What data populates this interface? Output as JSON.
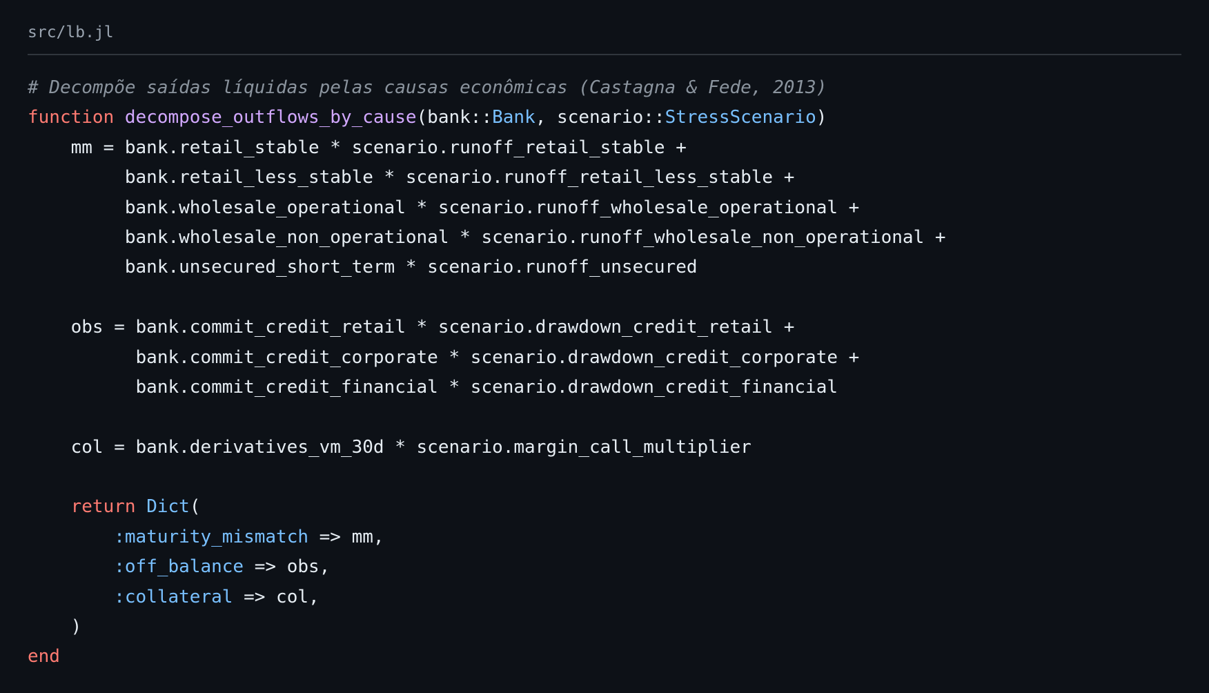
{
  "file": {
    "path": "src/lb.jl"
  },
  "colors": {
    "background": "#0d1117",
    "text": "#e6edf3",
    "comment": "#8b949e",
    "keyword": "#ff7b72",
    "function": "#d2a8ff",
    "type": "#79c0ff",
    "divider": "#30363d"
  },
  "code_lines": [
    [
      {
        "t": "comment",
        "v": "# Decompõe saídas líquidas pelas causas econômicas (Castagna & Fede, 2013)"
      }
    ],
    [
      {
        "t": "keyword",
        "v": "function"
      },
      {
        "t": "plain",
        "v": " "
      },
      {
        "t": "fn",
        "v": "decompose_outflows_by_cause"
      },
      {
        "t": "plain",
        "v": "(bank::"
      },
      {
        "t": "type",
        "v": "Bank"
      },
      {
        "t": "plain",
        "v": ", scenario::"
      },
      {
        "t": "type",
        "v": "StressScenario"
      },
      {
        "t": "plain",
        "v": ")"
      }
    ],
    [
      {
        "t": "plain",
        "v": "    mm = bank.retail_stable * scenario.runoff_retail_stable +"
      }
    ],
    [
      {
        "t": "plain",
        "v": "         bank.retail_less_stable * scenario.runoff_retail_less_stable +"
      }
    ],
    [
      {
        "t": "plain",
        "v": "         bank.wholesale_operational * scenario.runoff_wholesale_operational +"
      }
    ],
    [
      {
        "t": "plain",
        "v": "         bank.wholesale_non_operational * scenario.runoff_wholesale_non_operational +"
      }
    ],
    [
      {
        "t": "plain",
        "v": "         bank.unsecured_short_term * scenario.runoff_unsecured"
      }
    ],
    [
      {
        "t": "plain",
        "v": ""
      }
    ],
    [
      {
        "t": "plain",
        "v": "    obs = bank.commit_credit_retail * scenario.drawdown_credit_retail +"
      }
    ],
    [
      {
        "t": "plain",
        "v": "          bank.commit_credit_corporate * scenario.drawdown_credit_corporate +"
      }
    ],
    [
      {
        "t": "plain",
        "v": "          bank.commit_credit_financial * scenario.drawdown_credit_financial"
      }
    ],
    [
      {
        "t": "plain",
        "v": ""
      }
    ],
    [
      {
        "t": "plain",
        "v": "    col = bank.derivatives_vm_30d * scenario.margin_call_multiplier"
      }
    ],
    [
      {
        "t": "plain",
        "v": ""
      }
    ],
    [
      {
        "t": "plain",
        "v": "    "
      },
      {
        "t": "keyword",
        "v": "return"
      },
      {
        "t": "plain",
        "v": " "
      },
      {
        "t": "type",
        "v": "Dict"
      },
      {
        "t": "plain",
        "v": "("
      }
    ],
    [
      {
        "t": "plain",
        "v": "        "
      },
      {
        "t": "symbol",
        "v": ":maturity_mismatch"
      },
      {
        "t": "plain",
        "v": " => mm,"
      }
    ],
    [
      {
        "t": "plain",
        "v": "        "
      },
      {
        "t": "symbol",
        "v": ":off_balance"
      },
      {
        "t": "plain",
        "v": " => obs,"
      }
    ],
    [
      {
        "t": "plain",
        "v": "        "
      },
      {
        "t": "symbol",
        "v": ":collateral"
      },
      {
        "t": "plain",
        "v": " => col,"
      }
    ],
    [
      {
        "t": "plain",
        "v": "    )"
      }
    ],
    [
      {
        "t": "keyword",
        "v": "end"
      }
    ]
  ]
}
